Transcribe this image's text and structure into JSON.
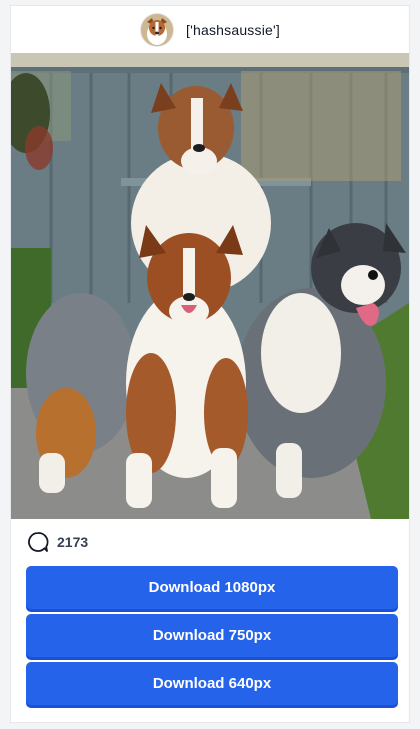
{
  "header": {
    "username": "['hashsaussie']",
    "avatar_icon": "dog-avatar"
  },
  "photo": {
    "subject": "three australian shepherd dogs"
  },
  "stats": {
    "comment_icon": "comment-bubble-icon",
    "comment_count": "2173"
  },
  "downloads": [
    {
      "label": "Download 1080px"
    },
    {
      "label": "Download 750px"
    },
    {
      "label": "Download 640px"
    }
  ],
  "colors": {
    "button": "#2563eb",
    "button_shadow": "#1d4ed8",
    "card_bg": "#ffffff",
    "page_bg": "#f3f4f6"
  }
}
